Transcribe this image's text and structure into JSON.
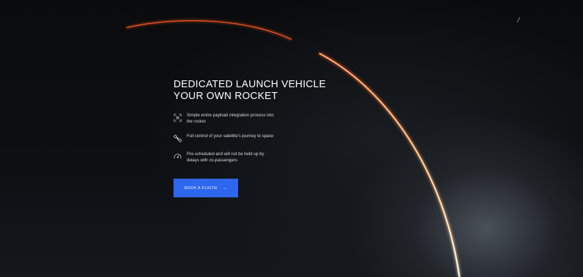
{
  "hero": {
    "title_line1": "DEDICATED LAUNCH VEHICLE",
    "title_line2": "YOUR OWN ROCKET"
  },
  "features": [
    {
      "icon": "integration-icon",
      "text": "Simple entire payload integration process into the rocket"
    },
    {
      "icon": "satellite-icon",
      "text": "Full control of your satellite's journey to space"
    },
    {
      "icon": "speedometer-icon",
      "text": "Pre-scheduled and will not be held up by delays with co-passengers"
    }
  ],
  "cta": {
    "label": "BOOK A FLIGTH",
    "arrow": "→"
  },
  "colors": {
    "accent": "#2f66f0",
    "background": "#0b0d10",
    "trail": "#ff8a3d"
  }
}
